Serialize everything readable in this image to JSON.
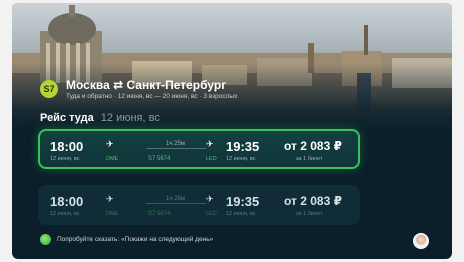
{
  "route": {
    "logo_text": "S7",
    "title": "Москва ⇄ Санкт-Петербург",
    "subtitle": "Туда и обратно · 12 июня, вс — 20 июня, вс · 3 взрослых"
  },
  "section": {
    "title": "Рейс туда",
    "date": "12 июня, вс"
  },
  "flights": [
    {
      "depart_time": "18:00",
      "depart_date": "12 июня, вс",
      "depart_code": "DME",
      "duration": "1ч 25м",
      "flight_no": "S7 5674",
      "arrive_time": "19:35",
      "arrive_code": "LED",
      "arrive_date": "12 июня, вс",
      "price": "от 2 083 ₽",
      "price_note": "за 1 билет"
    },
    {
      "depart_time": "18:00",
      "depart_date": "12 июня, вс",
      "depart_code": "DME",
      "duration": "1ч 25м",
      "flight_no": "S7 5674",
      "arrive_time": "19:35",
      "arrive_code": "LED",
      "arrive_date": "12 июня, вс",
      "price": "от 2 083 ₽",
      "price_note": "за 1 билет"
    }
  ],
  "voice_hint": "Попробуйте сказать: «Покажи на следующий день»",
  "icons": {
    "takeoff": "plane-takeoff-icon",
    "landing": "plane-landing-icon",
    "voice": "voice-assistant-icon",
    "avatar": "user-avatar"
  },
  "colors": {
    "accent": "#37c356",
    "background": "#0a1f2a",
    "brand": "#b7d431"
  }
}
